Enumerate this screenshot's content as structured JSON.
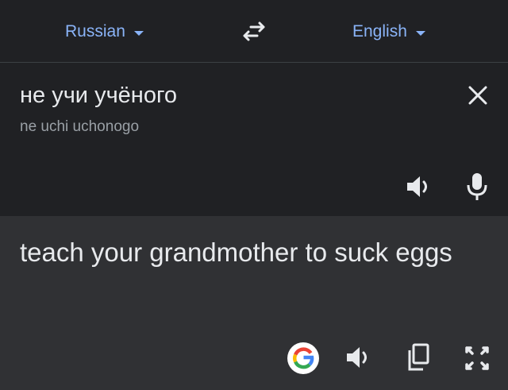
{
  "language_bar": {
    "source_language": "Russian",
    "target_language": "English"
  },
  "source": {
    "text": "не учи учёного",
    "transliteration": "ne uchi uchonogo"
  },
  "translation": {
    "text": "teach your grandmother to suck eggs"
  },
  "icons": {
    "swap": "swap-arrows-icon",
    "close": "close-icon",
    "source_speaker": "speaker-icon",
    "microphone": "microphone-icon",
    "google": "google-logo-icon",
    "target_speaker": "speaker-icon",
    "copy": "copy-icon",
    "fullscreen": "fullscreen-icon"
  },
  "colors": {
    "background": "#202124",
    "translation_panel": "#303134",
    "accent": "#8ab4f8",
    "text": "#e8eaed",
    "secondary_text": "#9aa0a6",
    "icon": "#e8eaed"
  }
}
